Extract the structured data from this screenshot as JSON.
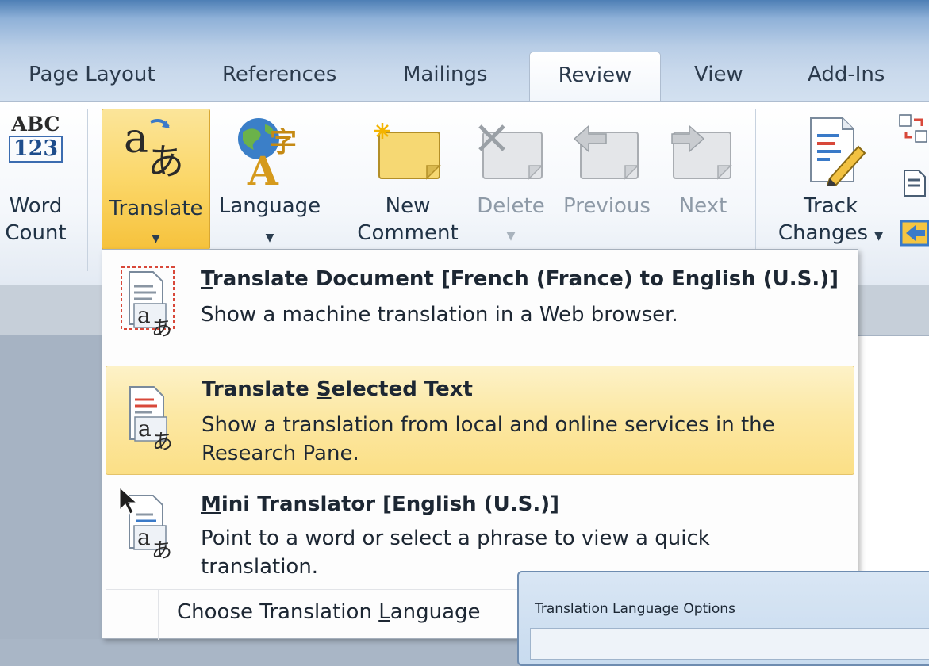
{
  "tabs": [
    {
      "label": "Page Layout"
    },
    {
      "label": "References"
    },
    {
      "label": "Mailings"
    },
    {
      "label": "Review",
      "active": true
    },
    {
      "label": "View"
    },
    {
      "label": "Add-Ins"
    }
  ],
  "ribbon": {
    "word_count": {
      "line1": "Word",
      "line2": "Count",
      "icon_top": "ABC",
      "icon_bottom": "123"
    },
    "translate": {
      "label": "Translate"
    },
    "language": {
      "label": "Language"
    },
    "new_comment": {
      "line1": "New",
      "line2": "Comment"
    },
    "delete": {
      "label": "Delete"
    },
    "previous": {
      "label": "Previous"
    },
    "next": {
      "label": "Next"
    },
    "track_changes": {
      "line1": "Track",
      "line2": "Changes"
    }
  },
  "menu": {
    "items": [
      {
        "title_before": "",
        "title_key": "T",
        "title_after": "ranslate Document [French (France) to English (U.S.)]",
        "desc": "Show a machine translation in a Web browser."
      },
      {
        "title_before": "Translate ",
        "title_key": "S",
        "title_after": "elected Text",
        "desc": "Show a translation from local and online services in the Research Pane."
      },
      {
        "title_before": "",
        "title_key": "M",
        "title_after": "ini Translator [English (U.S.)]",
        "desc": "Point to a word or select a phrase to view a quick translation."
      }
    ],
    "choose": {
      "before": "Choose Translation ",
      "key": "L",
      "after": "anguage"
    }
  },
  "dialog": {
    "title": "Translation Language Options"
  },
  "colors": {
    "highlight": "#fbe59a",
    "pressed_border": "#d8a733"
  }
}
